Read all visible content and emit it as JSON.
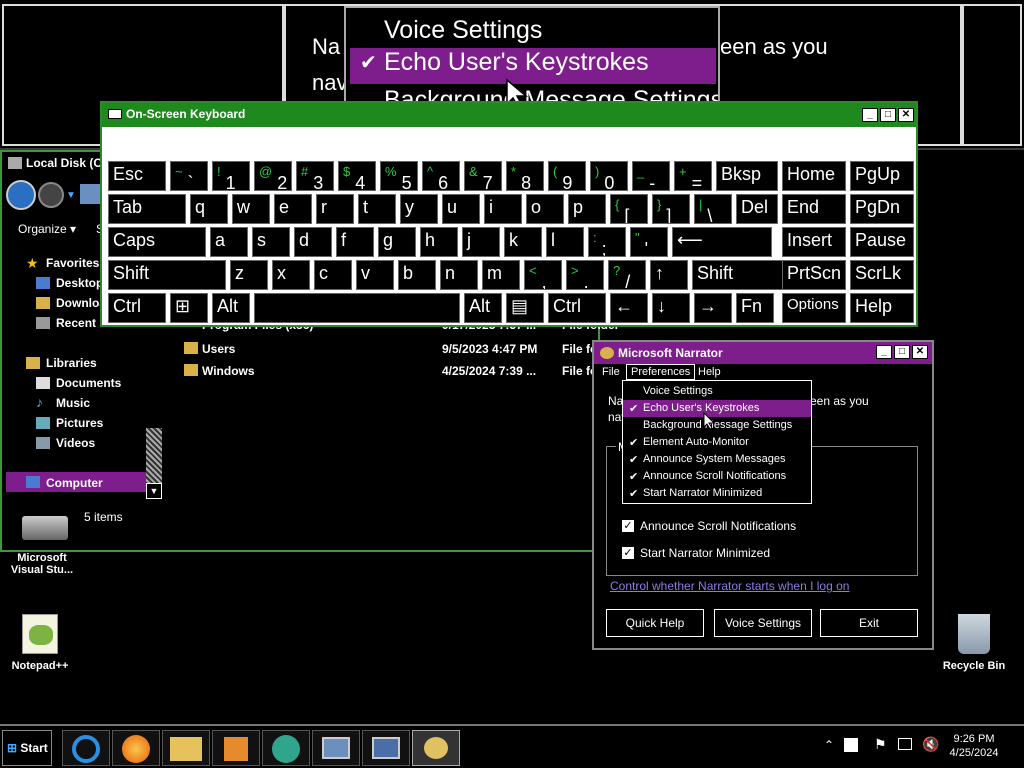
{
  "magnifier": {
    "left_text_1": "Na",
    "left_text_2": "nav",
    "right_text": "een as you",
    "menu": [
      "Voice Settings",
      "Echo User's Keystrokes",
      "Background Message Settings"
    ]
  },
  "explorer": {
    "title": "Local Disk (C",
    "toolbar": {
      "organize": "Organize ▾",
      "s": "S"
    },
    "favorites": "Favorites",
    "nav": [
      "Desktop",
      "Downloads",
      "Recent"
    ],
    "libraries": "Libraries",
    "lib_items": [
      "Documents",
      "Music",
      "Pictures",
      "Videos"
    ],
    "computer": "Computer",
    "items_count": "5 items",
    "rows": [
      {
        "name": "Program Files (x86)",
        "date": "9/17/2023 7:37 ...",
        "type": "File folder"
      },
      {
        "name": "Users",
        "date": "9/5/2023 4:47 PM",
        "type": "File fo"
      },
      {
        "name": "Windows",
        "date": "4/25/2024 7:39 ...",
        "type": "File fo"
      }
    ]
  },
  "osk": {
    "title": "On-Screen Keyboard",
    "row1": [
      {
        "m": "Esc"
      },
      {
        "s": "~",
        "m": "`"
      },
      {
        "s": "!",
        "m": "1"
      },
      {
        "s": "@",
        "m": "2"
      },
      {
        "s": "#",
        "m": "3"
      },
      {
        "s": "$",
        "m": "4"
      },
      {
        "s": "%",
        "m": "5"
      },
      {
        "s": "^",
        "m": "6"
      },
      {
        "s": "&",
        "m": "7"
      },
      {
        "s": "*",
        "m": "8"
      },
      {
        "s": "(",
        "m": "9"
      },
      {
        "s": ")",
        "m": "0"
      },
      {
        "s": "_",
        "m": "-"
      },
      {
        "s": "+",
        "m": "="
      },
      {
        "m": "Bksp"
      }
    ],
    "row2": [
      {
        "m": "Tab"
      },
      {
        "m": "q"
      },
      {
        "m": "w"
      },
      {
        "m": "e"
      },
      {
        "m": "r"
      },
      {
        "m": "t"
      },
      {
        "m": "y"
      },
      {
        "m": "u"
      },
      {
        "m": "i"
      },
      {
        "m": "o"
      },
      {
        "m": "p"
      },
      {
        "s": "{",
        "m": "["
      },
      {
        "s": "}",
        "m": "]"
      },
      {
        "s": "|",
        "m": "\\"
      },
      {
        "m": "Del"
      }
    ],
    "row3": [
      {
        "m": "Caps"
      },
      {
        "m": "a"
      },
      {
        "m": "s"
      },
      {
        "m": "d"
      },
      {
        "m": "f"
      },
      {
        "m": "g"
      },
      {
        "m": "h"
      },
      {
        "m": "j"
      },
      {
        "m": "k"
      },
      {
        "m": "l"
      },
      {
        "s": ":",
        "m": ";"
      },
      {
        "s": "\"",
        "m": "'"
      },
      {
        "m": "⟵"
      }
    ],
    "row4": [
      {
        "m": "Shift"
      },
      {
        "m": "z"
      },
      {
        "m": "x"
      },
      {
        "m": "c"
      },
      {
        "m": "v"
      },
      {
        "m": "b"
      },
      {
        "m": "n"
      },
      {
        "m": "m"
      },
      {
        "s": "<",
        "m": ","
      },
      {
        "s": ">",
        "m": "."
      },
      {
        "s": "?",
        "m": "/"
      },
      {
        "m": "↑"
      },
      {
        "m": "Shift"
      }
    ],
    "row5": [
      {
        "m": "Ctrl"
      },
      {
        "m": "⊞"
      },
      {
        "m": "Alt"
      },
      {
        "m": ""
      },
      {
        "m": "Alt"
      },
      {
        "m": "▤"
      },
      {
        "m": "Ctrl"
      },
      {
        "m": "←"
      },
      {
        "m": "↓"
      },
      {
        "m": "→"
      },
      {
        "m": "Fn"
      }
    ],
    "nav": [
      "Home",
      "PgUp",
      "End",
      "PgDn",
      "Insert",
      "Pause",
      "PrtScn",
      "ScrLk",
      "Options",
      "Help"
    ]
  },
  "narrator": {
    "title": "Microsoft Narrator",
    "menubar": [
      "File",
      "Preferences",
      "Help"
    ],
    "body_text_1": "Na",
    "body_text_2": "nav",
    "body_text_right": "een as you",
    "group_label": "M",
    "checks": [
      "Announce Scroll Notifications",
      "Start Narrator Minimized"
    ],
    "link": "Control whether Narrator starts when I log on",
    "buttons": [
      "Quick Help",
      "Voice Settings",
      "Exit"
    ]
  },
  "prefs_menu": [
    {
      "label": "Voice Settings",
      "checked": false,
      "hl": false
    },
    {
      "label": "Echo User's Keystrokes",
      "checked": true,
      "hl": true
    },
    {
      "label": "Background Message Settings",
      "checked": false,
      "hl": false
    },
    {
      "label": "Element Auto-Monitor",
      "checked": true,
      "hl": false
    },
    {
      "label": "Announce System Messages",
      "checked": true,
      "hl": false
    },
    {
      "label": "Announce Scroll Notifications",
      "checked": true,
      "hl": false
    },
    {
      "label": "Start Narrator Minimized",
      "checked": true,
      "hl": false
    }
  ],
  "desktop": {
    "vs_label": "Microsoft Visual Stu...",
    "notepad": "Notepad++",
    "recycle": "Recycle Bin"
  },
  "taskbar": {
    "start": "Start",
    "time": "9:26 PM",
    "date": "4/25/2024"
  },
  "colors": {
    "accent": "#7e1d8c",
    "osk_title": "#1e8a1e"
  }
}
